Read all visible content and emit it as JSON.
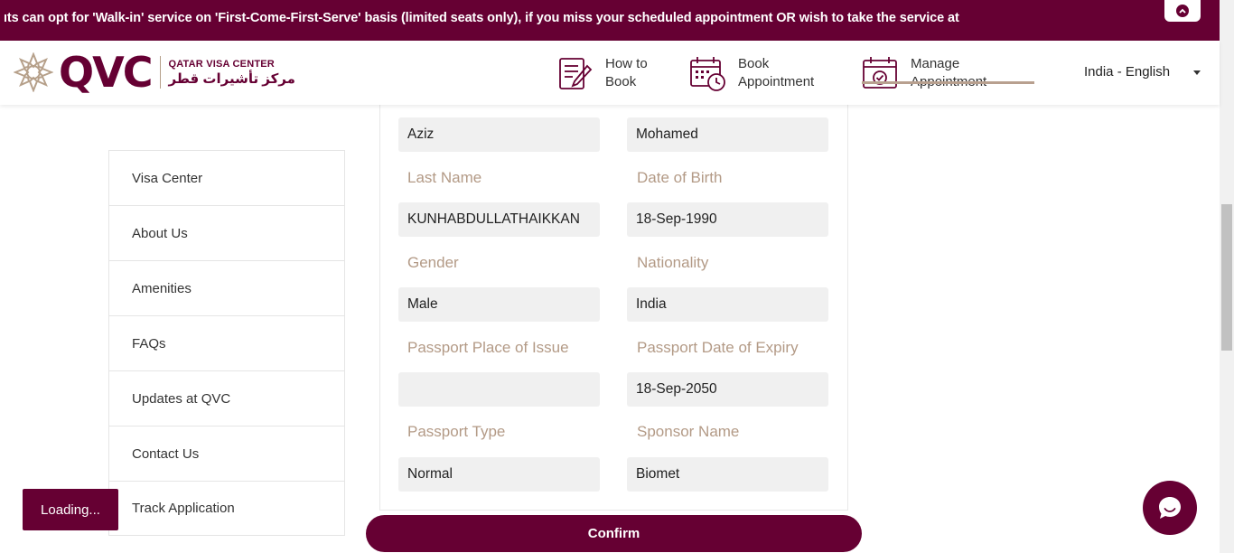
{
  "marquee": {
    "text": "ıts can opt for 'Walk-in' service on 'First-Come-First-Serve' basis (limited seats only), if you miss your scheduled appointment OR wish to take the service at"
  },
  "header": {
    "logo": {
      "brand": "QVC",
      "name_en": "QATAR VISA CENTER",
      "name_ar": "مركز تأشيرات قطر"
    },
    "nav": [
      {
        "label_line1": "How to",
        "label_line2": "Book",
        "icon": "notepad-pen-icon"
      },
      {
        "label_line1": "Book",
        "label_line2": "Appointment",
        "icon": "calendar-clock-icon"
      },
      {
        "label_line1": "Manage",
        "label_line2": "Appointment",
        "icon": "calendar-check-icon"
      }
    ],
    "language": "India - English"
  },
  "sidebar": {
    "items": [
      {
        "label": "Visa Center"
      },
      {
        "label": "About Us"
      },
      {
        "label": "Amenities"
      },
      {
        "label": "FAQs"
      },
      {
        "label": "Updates at QVC"
      },
      {
        "label": "Contact Us"
      },
      {
        "label": "Track Application"
      }
    ]
  },
  "form": {
    "first_name": "Aziz",
    "middle_name": "Mohamed",
    "last_name_label": "Last Name",
    "last_name": "KUNHABDULLATHAIKKAN",
    "dob_label": "Date of Birth",
    "dob": "18-Sep-1990",
    "gender_label": "Gender",
    "gender": "Male",
    "nationality_label": "Nationality",
    "nationality": "India",
    "passport_issue_place_label": "Passport Place of Issue",
    "passport_issue_place": "",
    "passport_expiry_label": "Passport Date of Expiry",
    "passport_expiry": "18-Sep-2050",
    "passport_type_label": "Passport Type",
    "passport_type": "Normal",
    "sponsor_name_label": "Sponsor Name",
    "sponsor_name": "Biomet"
  },
  "actions": {
    "confirm_label": "Confirm",
    "loading_label": "Loading..."
  },
  "colors": {
    "brand": "#660033",
    "label": "#b39a86",
    "field_bg": "#f0f0f0"
  }
}
